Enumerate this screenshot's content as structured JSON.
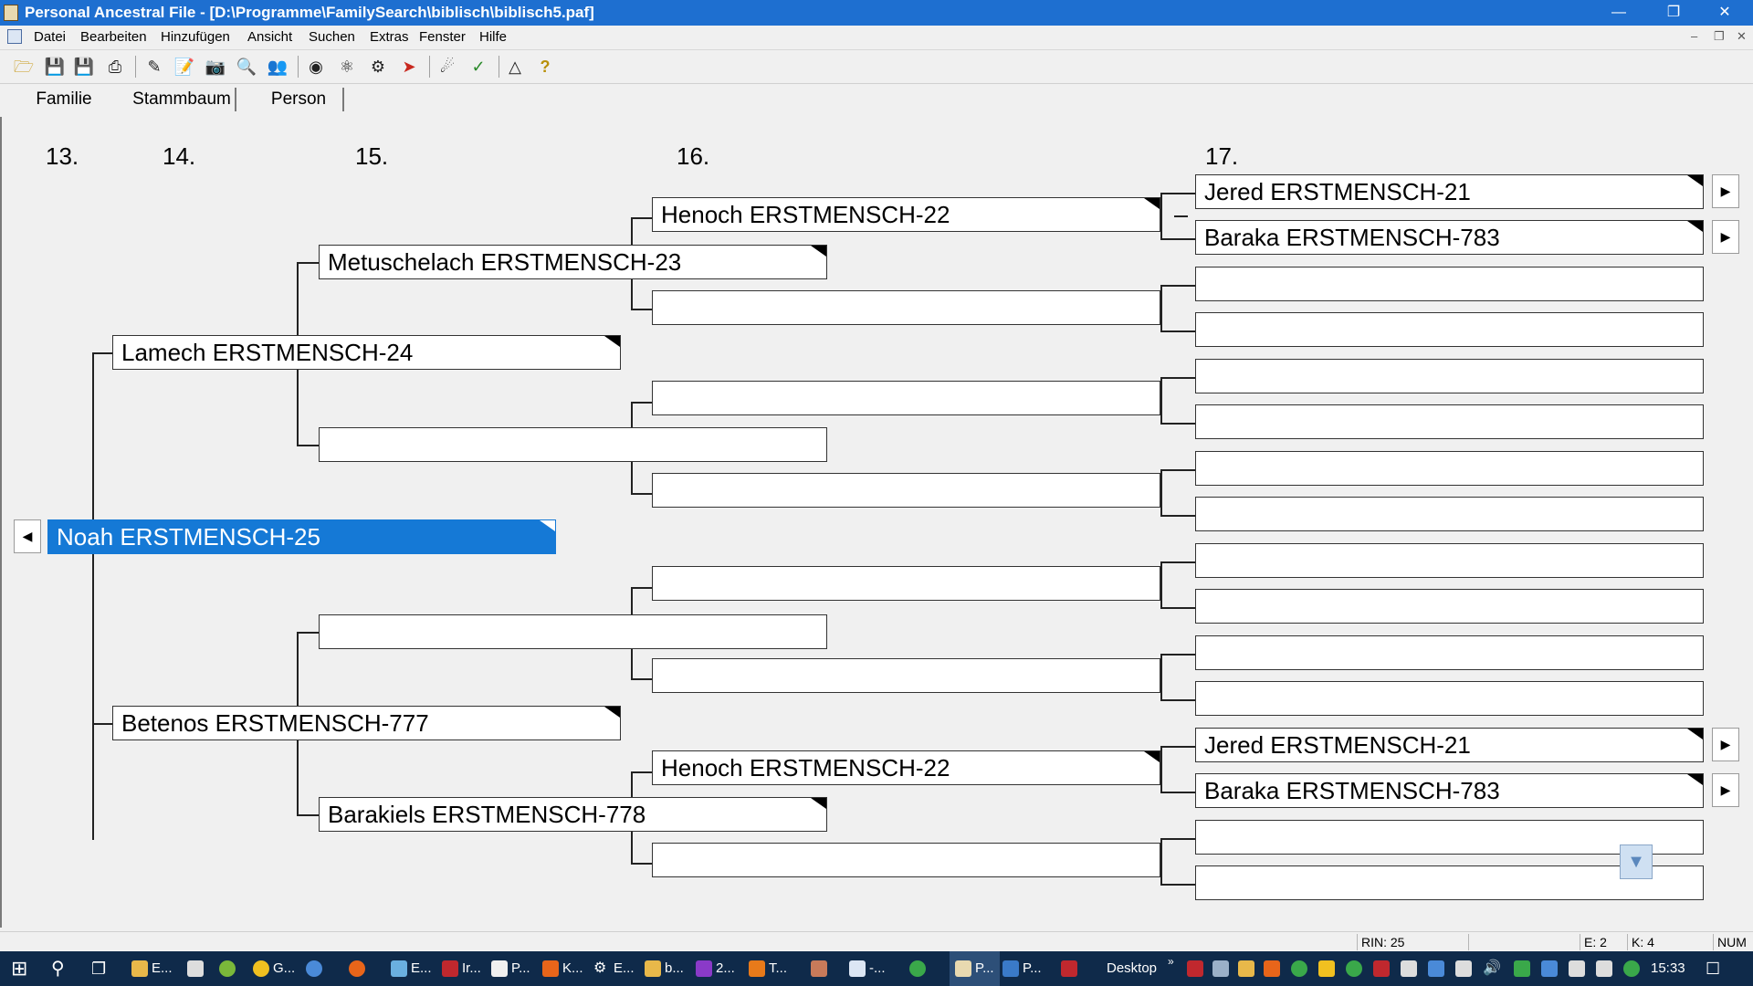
{
  "window": {
    "title": "Personal Ancestral File - [D:\\Programme\\FamilySearch\\biblisch\\biblisch5.paf]",
    "minimize_icon": "minimize-icon",
    "maximize_icon": "restore-icon",
    "close_icon": "close-icon"
  },
  "menu": {
    "items": [
      "Datei",
      "Bearbeiten",
      "Hinzufügen",
      "Ansicht",
      "Suchen",
      "Extras",
      "Fenster",
      "Hilfe"
    ]
  },
  "toolbar": {
    "icons": [
      "open-folder-icon",
      "save-icon",
      "save-as-icon",
      "print-icon",
      "edit-individual-icon",
      "notes-icon",
      "camera-icon",
      "find-icon",
      "match-merge-icon",
      "binoculars-icon",
      "search-icon",
      "research-icon",
      "export-icon",
      "navigate-icon",
      "sources-icon",
      "family-tree-icon",
      "help-icon"
    ]
  },
  "tabs": [
    "Familie",
    "Stammbaum",
    "Person"
  ],
  "generations": [
    "13.",
    "14.",
    "15.",
    "16.",
    "17."
  ],
  "tree": {
    "root": "Noah ERSTMENSCH-25",
    "gen14": [
      "Lamech ERSTMENSCH-24",
      "Betenos ERSTMENSCH-777"
    ],
    "gen15": [
      "Metuschelach ERSTMENSCH-23",
      "",
      "",
      "Barakiels ERSTMENSCH-778"
    ],
    "gen16": [
      "Henoch ERSTMENSCH-22",
      "",
      "",
      "",
      "",
      "",
      "Henoch ERSTMENSCH-22",
      ""
    ],
    "gen17": [
      "Jered ERSTMENSCH-21",
      "Baraka ERSTMENSCH-783",
      "",
      "",
      "",
      "",
      "",
      "",
      "",
      "",
      "",
      "",
      "Jered ERSTMENSCH-21",
      "Baraka ERSTMENSCH-783",
      "",
      ""
    ]
  },
  "statusbar": {
    "rin": "RIN: 25",
    "e": "E: 2",
    "k": "K: 4",
    "num": "NUM"
  },
  "taskbar": {
    "apps": [
      "E...",
      "G...",
      "E...",
      "Ir...",
      "P...",
      "K...",
      "E...",
      "b...",
      "2...",
      "T...",
      "-...",
      "P...",
      "P..."
    ],
    "desktop_label": "Desktop",
    "clock": "15:33"
  }
}
